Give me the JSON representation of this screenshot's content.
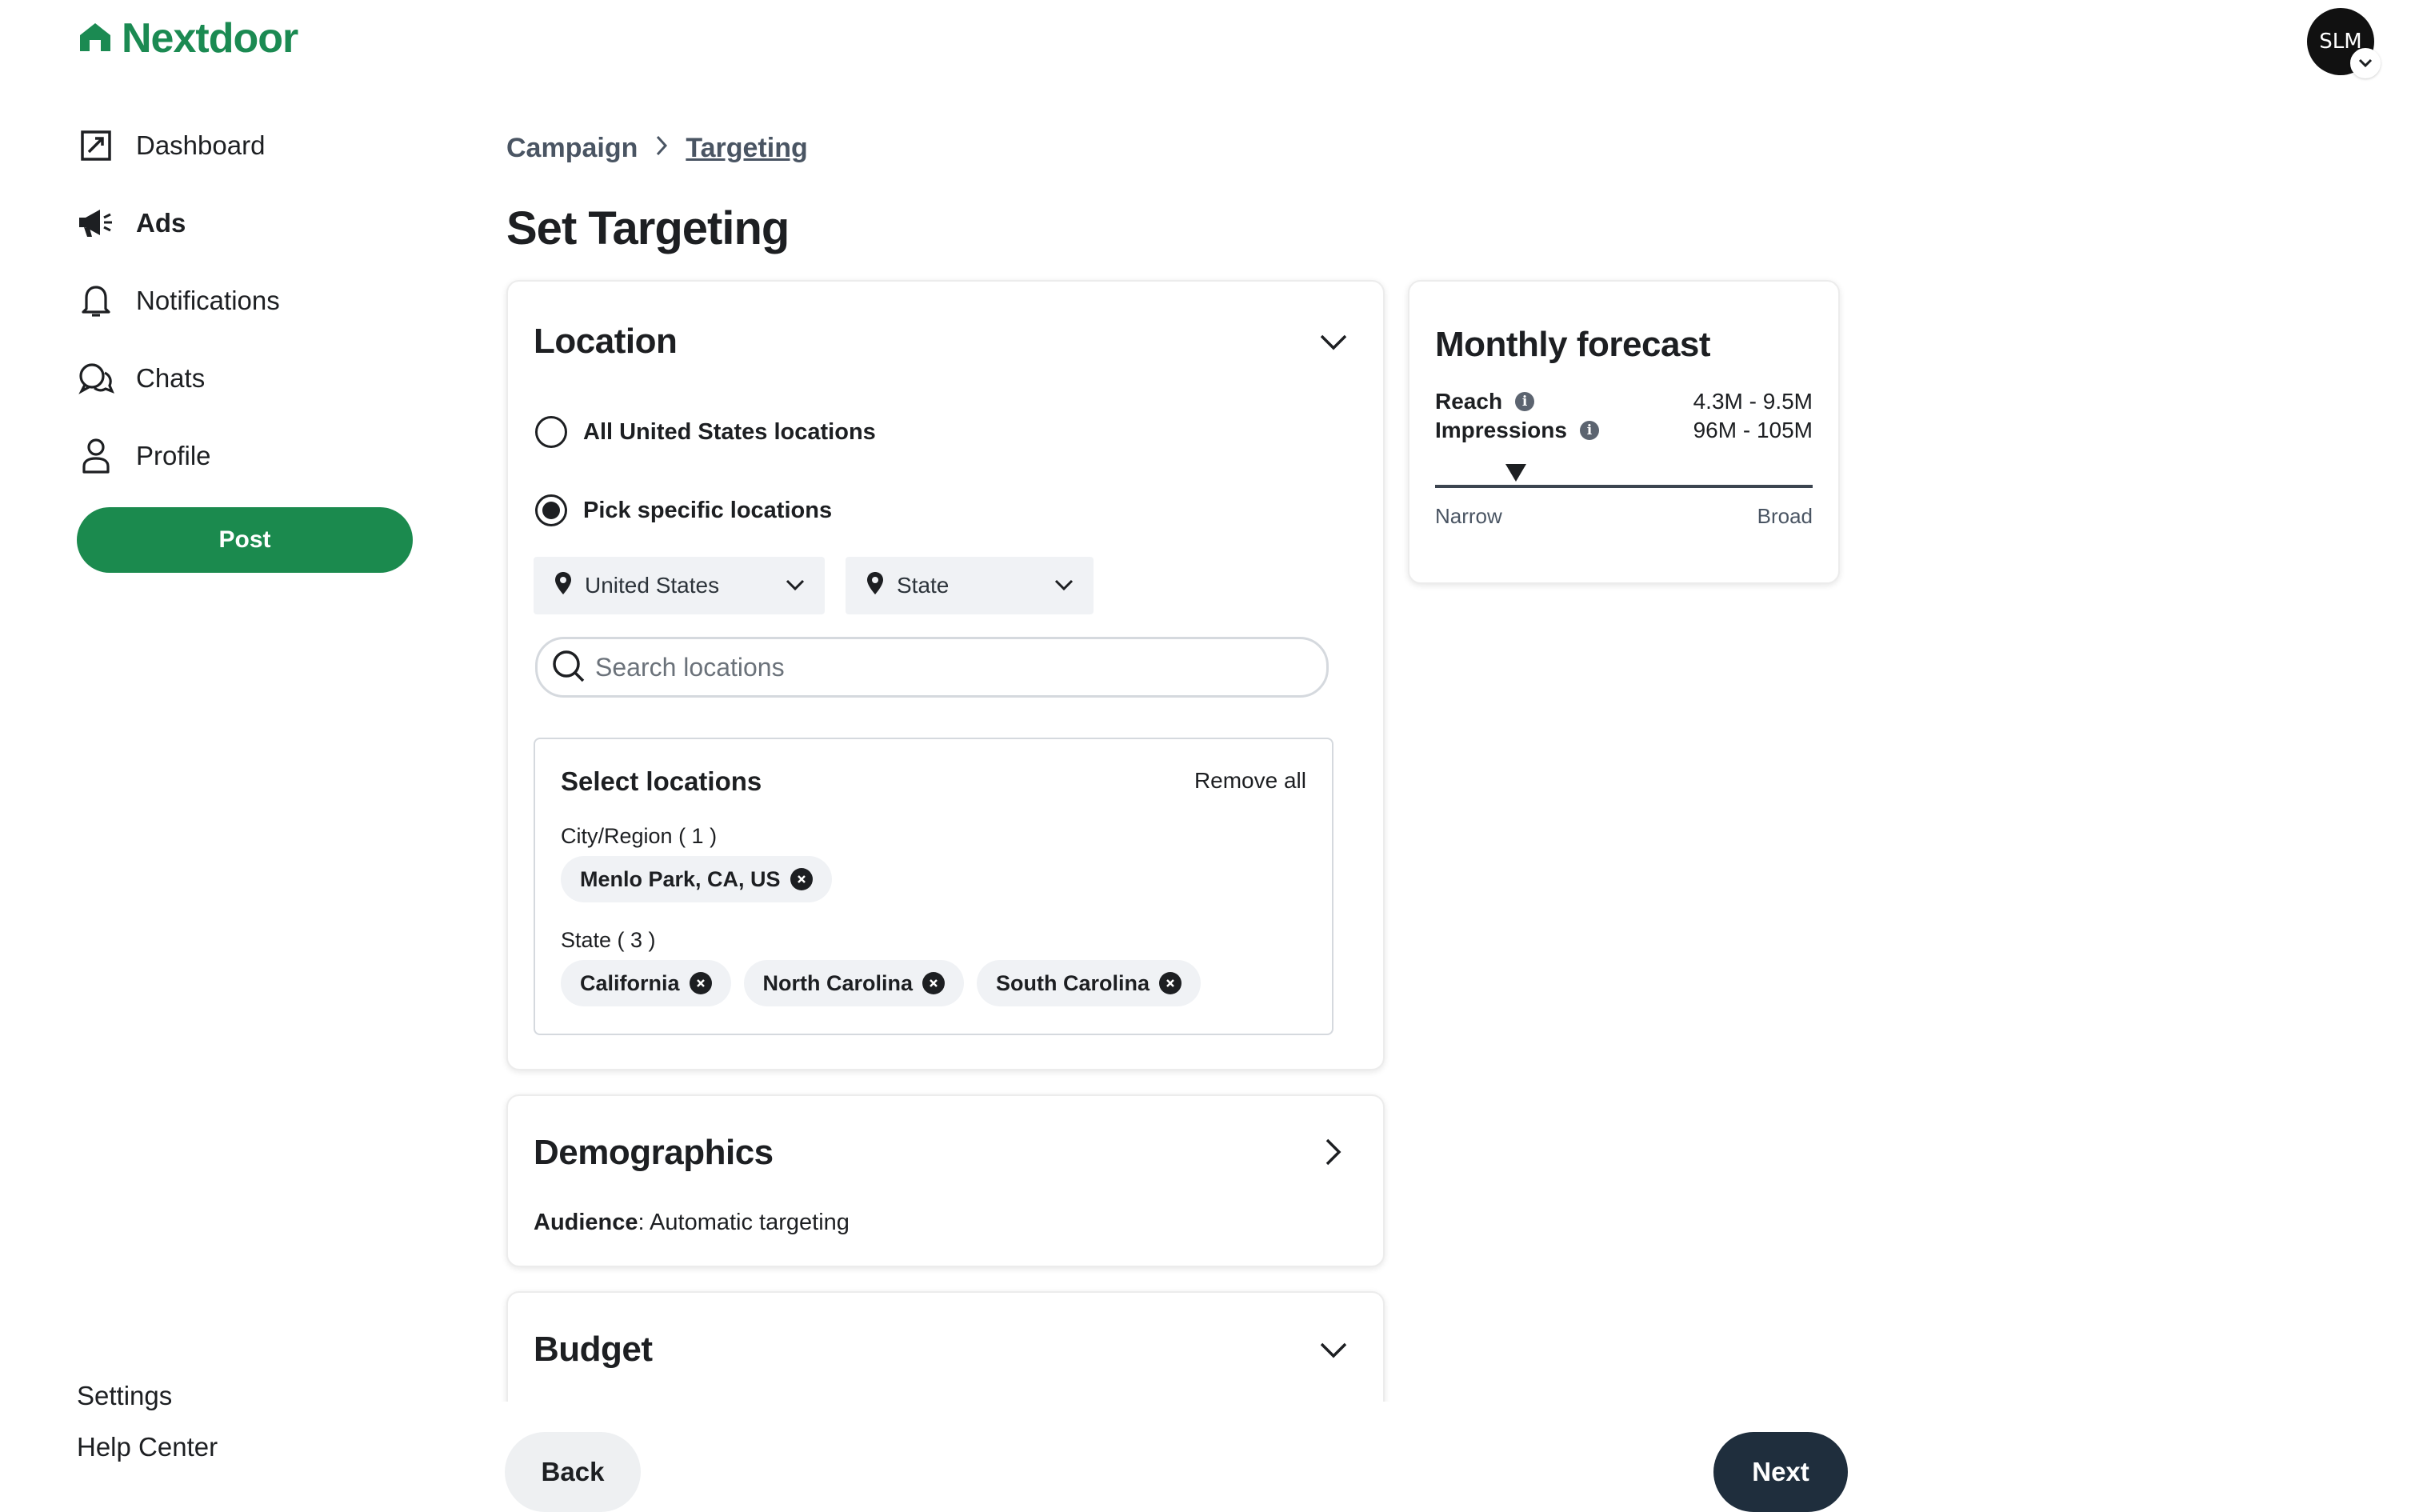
{
  "app": {
    "name": "Nextdoor",
    "brand_color": "#1b8a52"
  },
  "user": {
    "avatar_text": "SLM"
  },
  "nav": {
    "items": [
      {
        "label": "Dashboard",
        "icon": "dashboard-icon"
      },
      {
        "label": "Ads",
        "icon": "megaphone-icon",
        "active": true
      },
      {
        "label": "Notifications",
        "icon": "bell-icon"
      },
      {
        "label": "Chats",
        "icon": "chat-bubbles-icon"
      },
      {
        "label": "Profile",
        "icon": "person-icon"
      }
    ],
    "post_label": "Post",
    "bottom": [
      "Settings",
      "Help Center"
    ]
  },
  "breadcrumb": {
    "parent": "Campaign",
    "current": "Targeting"
  },
  "page_title": "Set Targeting",
  "location": {
    "title": "Location",
    "options": [
      "All United States locations",
      "Pick specific locations"
    ],
    "selected_option": 1,
    "country_dropdown": "United States",
    "state_dropdown": "State",
    "search_placeholder": "Search locations",
    "selected": {
      "title": "Select locations",
      "remove_all": "Remove all",
      "city_group_label": "City/Region ( 1 )",
      "cities": [
        "Menlo Park, CA, US"
      ],
      "state_group_label": "State ( 3 )",
      "states": [
        "California",
        "North Carolina",
        "South Carolina"
      ]
    }
  },
  "demographics": {
    "title": "Demographics",
    "audience_label": "Audience",
    "audience_value": ": Automatic targeting"
  },
  "budget": {
    "title": "Budget"
  },
  "forecast": {
    "title": "Monthly forecast",
    "reach_label": "Reach",
    "reach_value": "4.3M - 9.5M",
    "impressions_label": "Impressions",
    "impressions_value": "96M - 105M",
    "narrow_label": "Narrow",
    "broad_label": "Broad"
  },
  "footer": {
    "back_label": "Back",
    "next_label": "Next"
  }
}
